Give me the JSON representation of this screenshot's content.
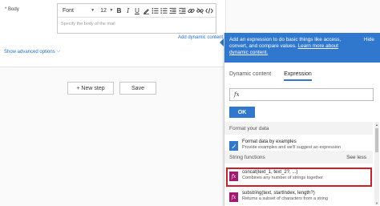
{
  "editor": {
    "field_label": "Body",
    "required_mark": "*",
    "font_value": "Font",
    "size_value": "12",
    "placeholder": "Specify the body of the mail",
    "add_dynamic_content": "Add dynamic content",
    "show_advanced": "Show advanced options"
  },
  "toolbar": {
    "bold": "B",
    "italic": "I",
    "underline": "U"
  },
  "actions": {
    "new_step": "+ New step",
    "save": "Save"
  },
  "panel": {
    "banner_text": "Add an expression to do basic things like access, convert, and compare values.",
    "banner_link": "Learn more about dynamic content.",
    "hide": "Hide",
    "tabs": [
      "Dynamic content",
      "Expression"
    ],
    "active_tab": "Expression",
    "expression_icon": "fx",
    "ok_label": "OK",
    "sections": [
      {
        "title": "Format your data",
        "items": [
          {
            "title": "Format data by examples",
            "desc": "Provide examples and we'll suggest an expression",
            "icon": "format-icon"
          }
        ]
      },
      {
        "title": "String functions",
        "toggle": "See less",
        "items": [
          {
            "title": "concat(text_1, text_2?, ...)",
            "desc": "Combines any number of strings together",
            "icon": "fx"
          },
          {
            "title": "substring(text, startIndex, length?)",
            "desc": "Returns a subset of characters from a string",
            "icon": "fx"
          }
        ]
      }
    ]
  },
  "colors": {
    "accent": "#2f78ce",
    "function_icon": "#a3196f",
    "highlight": "#d21f25"
  }
}
